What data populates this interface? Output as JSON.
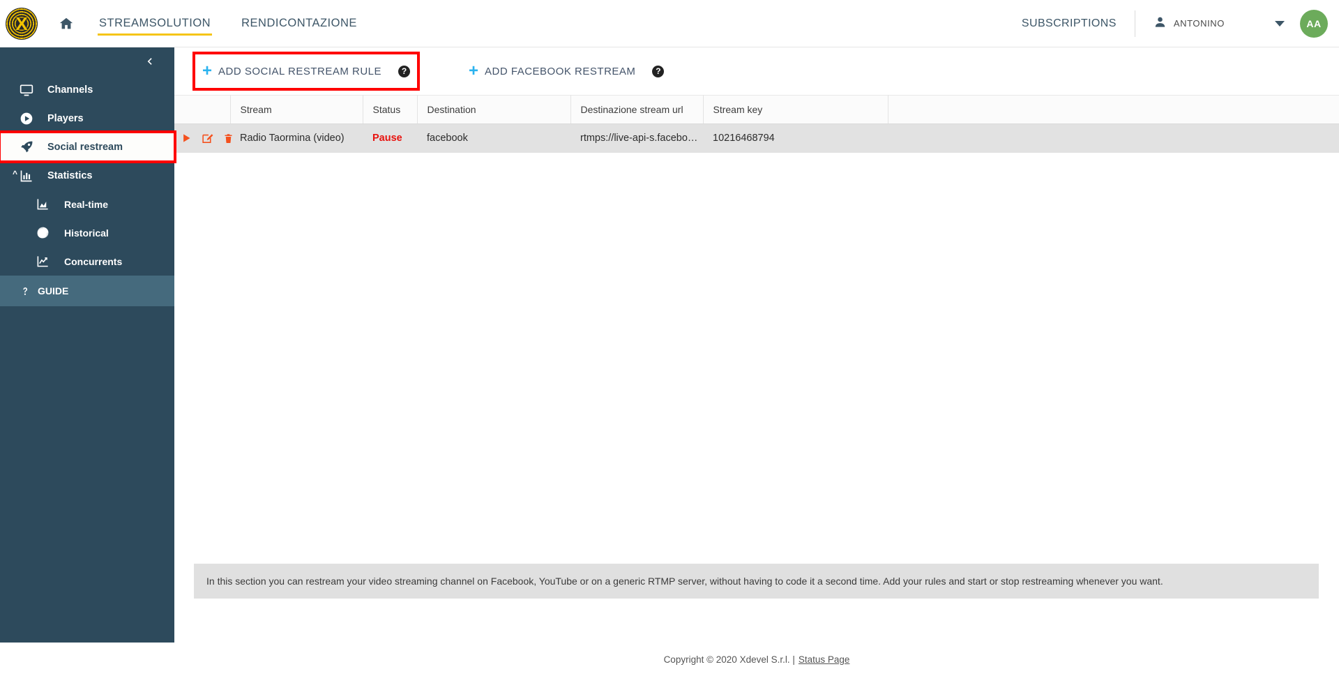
{
  "header": {
    "logo_icon": "xdevel-logo-icon",
    "logo_letter": "X",
    "home_icon": "home-icon",
    "tabs": [
      {
        "label": "STREAMSOLUTION",
        "active": true
      },
      {
        "label": "RENDICONTAZIONE",
        "active": false
      }
    ],
    "subscriptions_label": "SUBSCRIPTIONS",
    "user_icon": "person-icon",
    "user_name": "ANTONINO",
    "caret_icon": "chevron-down-icon",
    "avatar_initials": "AA",
    "avatar_color": "#6cab5b",
    "active_tab_underline_color": "#f5c518"
  },
  "sidebar": {
    "collapse_icon": "chevron-left-icon",
    "background_color": "#2d4a5c",
    "items": [
      {
        "label": "Channels",
        "icon": "monitor-icon",
        "selected": false
      },
      {
        "label": "Players",
        "icon": "play-circle-icon",
        "selected": false
      },
      {
        "label": "Social restream",
        "icon": "rocket-icon",
        "selected": true
      },
      {
        "label": "Statistics",
        "icon": "bar-chart-icon",
        "selected": false,
        "expanded": true
      },
      {
        "label": "Real-time",
        "icon": "area-chart-icon",
        "selected": false,
        "sub": true
      },
      {
        "label": "Historical",
        "icon": "pie-chart-icon",
        "selected": false,
        "sub": true
      },
      {
        "label": "Concurrents",
        "icon": "line-chart-icon",
        "selected": false,
        "sub": true
      }
    ],
    "guide": {
      "label": "GUIDE",
      "icon": "question-mark-icon"
    },
    "highlight_color": "#ff0000"
  },
  "toolbar": {
    "buttons": [
      {
        "label": "ADD SOCIAL RESTREAM RULE",
        "plus_icon": "plus-icon",
        "help_icon": "help-circle-icon",
        "highlighted": true
      },
      {
        "label": "ADD FACEBOOK RESTREAM",
        "plus_icon": "plus-icon",
        "help_icon": "help-circle-icon",
        "highlighted": false
      }
    ],
    "plus_color": "#2bb3ef"
  },
  "table": {
    "columns": [
      "",
      "Stream",
      "Status",
      "Destination",
      "Destinazione stream url",
      "Stream key",
      ""
    ],
    "rows": [
      {
        "actions": [
          "play-icon",
          "edit-icon",
          "delete-icon"
        ],
        "stream": "Radio Taormina (video)",
        "status": "Pause",
        "status_color": "#e8130f",
        "destination": "facebook",
        "destination_stream_url": "rtmps://live-api-s.facebo…",
        "stream_key": "10216468794"
      }
    ],
    "action_icon_color": "#f4511e"
  },
  "info_panel": {
    "text": "In this section you can restream your video streaming channel on Facebook, YouTube or on a generic RTMP server, without having to code it a second time. Add your rules and start or stop restreaming whenever you want."
  },
  "footer": {
    "copyright": "Copyright © 2020 Xdevel S.r.l. |",
    "status_page_label": "Status Page"
  }
}
